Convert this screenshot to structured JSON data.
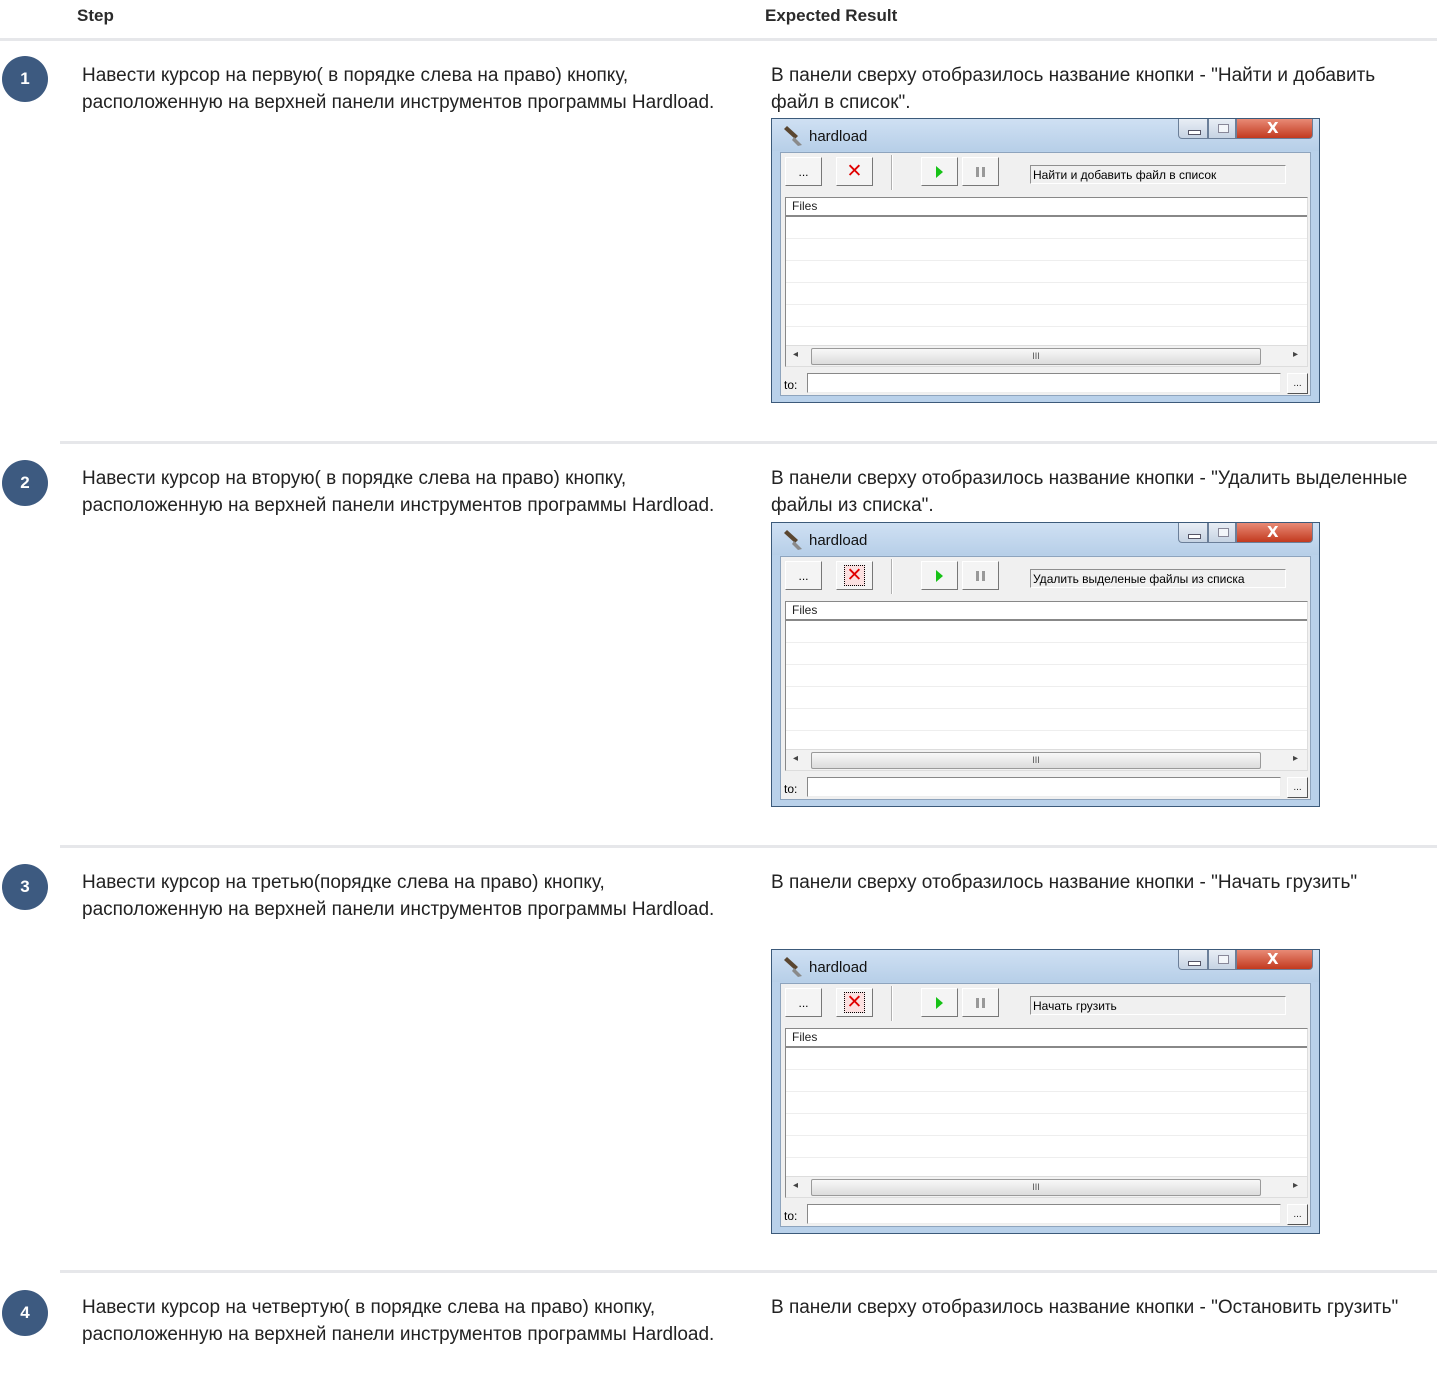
{
  "header": {
    "step_label": "Step",
    "expected_label": "Expected Result"
  },
  "rows": [
    {
      "number": "1",
      "step": "Навести курсор на первую( в порядке слева на право) кнопку, расположенную на верхней панели инструментов программы Hardload.",
      "expected": "В панели сверху отобразилось название кнопки - \"Найти и добавить файл в список\".",
      "window": {
        "title": "hardload",
        "tooltip": "Найти и добавить файл в список",
        "x_button_focused": false
      }
    },
    {
      "number": "2",
      "step": "Навести курсор на вторую( в порядке слева на право) кнопку, расположенную на верхней панели инструментов программы Hardload.",
      "expected": "В панели сверху отобразилось название кнопки - \"Удалить выделенные файлы из списка\".",
      "window": {
        "title": "hardload",
        "tooltip": "Удалить выделеные файлы из списка",
        "x_button_focused": true
      }
    },
    {
      "number": "3",
      "step": "Навести курсор на третью(порядке слева на право) кнопку, расположенную на верхней панели инструментов программы Hardload.",
      "expected": "В панели сверху отобразилось название кнопки - \"Начать грузить\"",
      "window": {
        "title": "hardload",
        "tooltip": "Начать грузить",
        "x_button_focused": true
      }
    },
    {
      "number": "4",
      "step": "Навести курсор на четвертую( в порядке слева на право) кнопку, расположенную на верхней панели инструментов программы Hardload.",
      "expected": "В панели сверху отобразилось название кнопки - \"Остановить грузить\""
    }
  ],
  "window_common": {
    "browse_label": "...",
    "files_header": "Files",
    "scroll_grip": "III",
    "to_label": "to:",
    "icons": [
      "browse-icon",
      "delete-x-icon",
      "play-icon",
      "pause-icon"
    ]
  },
  "colors": {
    "badge": "#3d5a80",
    "play": "#17c217",
    "delete": "#e00000",
    "close_button": "#c23a1f"
  }
}
